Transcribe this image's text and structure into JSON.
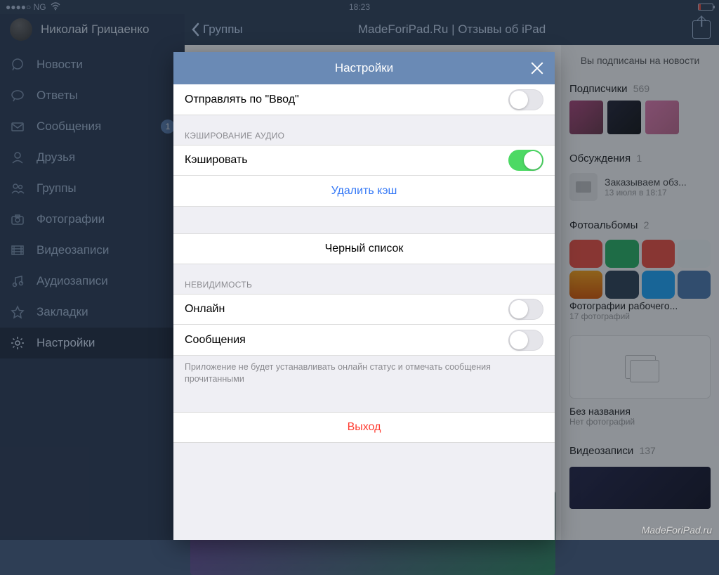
{
  "statusbar": {
    "carrier": "●●●●○ NG",
    "wifi": "􀙇",
    "time": "18:23"
  },
  "topnav": {
    "back": "Группы",
    "title": "MadeForiPad.Ru | Отзывы об iPad"
  },
  "profile": {
    "name": "Николай Грицаенко"
  },
  "sidebar": [
    {
      "key": "news",
      "label": "Новости"
    },
    {
      "key": "replies",
      "label": "Ответы"
    },
    {
      "key": "messages",
      "label": "Сообщения",
      "badge": "1"
    },
    {
      "key": "friends",
      "label": "Друзья"
    },
    {
      "key": "groups",
      "label": "Группы"
    },
    {
      "key": "photos",
      "label": "Фотографии"
    },
    {
      "key": "videos",
      "label": "Видеозаписи"
    },
    {
      "key": "audio",
      "label": "Аудиозаписи"
    },
    {
      "key": "bookmarks",
      "label": "Закладки"
    },
    {
      "key": "settings",
      "label": "Настройки",
      "selected": true
    }
  ],
  "modal": {
    "title": "Настройки",
    "rows": {
      "send_on_enter": "Отправлять по \"Ввод\"",
      "cache_section": "КЭШИРОВАНИЕ АУДИО",
      "cache": "Кэшировать",
      "clear_cache": "Удалить кэш",
      "blacklist": "Черный список",
      "invis_section": "НЕВИДИМОСТЬ",
      "online": "Онлайн",
      "messages": "Сообщения",
      "note": "Приложение не будет устанавливать онлайн статус и отмечать сообщения прочитанными",
      "logout": "Выход"
    },
    "toggles": {
      "send_on_enter": false,
      "cache": true,
      "online": false,
      "messages": false
    }
  },
  "rightcol": {
    "subscribed": "Вы подписаны на новости",
    "subs_label": "Подписчики",
    "subs_count": "569",
    "disc_label": "Обсуждения",
    "disc_count": "1",
    "disc_title": "Заказываем обз...",
    "disc_date": "13 июля в 18:17",
    "albums_label": "Фотоальбомы",
    "albums_count": "2",
    "album1_title": "Фотографии рабочего...",
    "album1_sub": "17 фотографий",
    "album2_title": "Без названия",
    "album2_sub": "Нет фотографий",
    "videos_label": "Видеозаписи",
    "videos_count": "137"
  },
  "watermark": "MadeForiPad.ru"
}
